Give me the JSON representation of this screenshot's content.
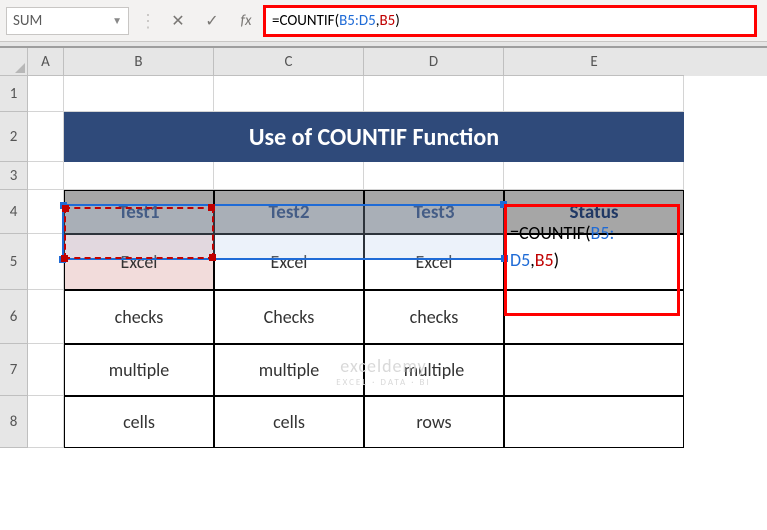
{
  "name_box": "SUM",
  "formula": {
    "eq": "=",
    "fn": "COUNTIF",
    "open": "(",
    "ref1": "B5:D5",
    "comma": ",",
    "ref2": "B5",
    "close": ")"
  },
  "cell_edit": {
    "eq": "=",
    "fn": "COUNTIF",
    "open": "(",
    "ref1a": "B5:",
    "ref1b": "D5",
    "comma": ",",
    "ref2": "B5",
    "close": ")"
  },
  "columns": [
    "A",
    "B",
    "C",
    "D",
    "E"
  ],
  "rows": [
    "1",
    "2",
    "3",
    "4",
    "5",
    "6",
    "7",
    "8"
  ],
  "title": "Use of COUNTIF Function",
  "headers": {
    "b": "Test1",
    "c": "Test2",
    "d": "Test3",
    "e": "Status"
  },
  "data": {
    "r5": {
      "b": "Excel",
      "c": "Excel",
      "d": "Excel"
    },
    "r6": {
      "b": "checks",
      "c": "Checks",
      "d": "checks"
    },
    "r7": {
      "b": "multiple",
      "c": "multiple",
      "d": "multiple"
    },
    "r8": {
      "b": "cells",
      "c": "cells",
      "d": "rows"
    }
  },
  "watermark": {
    "big": "exceldemy",
    "small": "EXCEL · DATA · BI"
  },
  "icons": {
    "cancel": "✕",
    "enter": "✓",
    "fx": "fx",
    "dropdown": "▼"
  }
}
